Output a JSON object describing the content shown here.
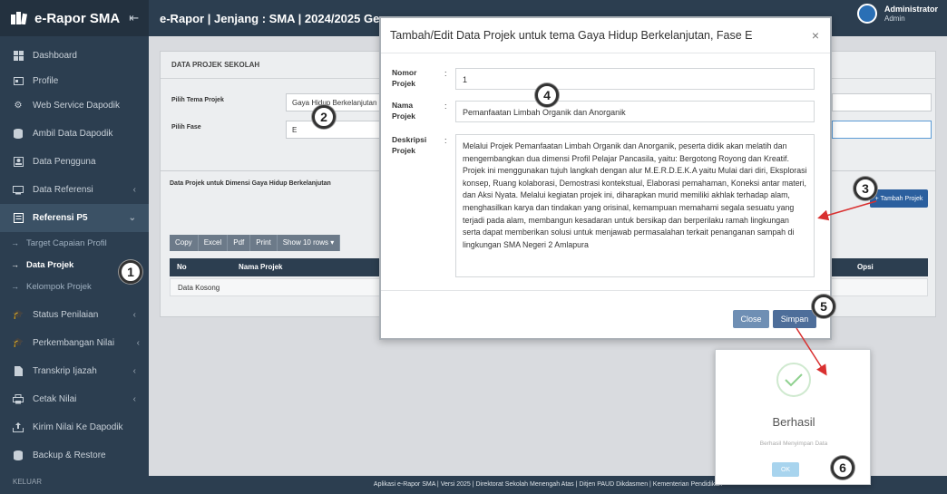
{
  "app": {
    "brand": "e-Rapor SMA",
    "topbar_title": "e-Rapor | Jenjang : SMA | 2024/2025 Ge",
    "user_name": "Administrator",
    "user_role": "Admin"
  },
  "sidebar": {
    "items": [
      {
        "label": "Dashboard",
        "icon": "dashboard-icon"
      },
      {
        "label": "Profile",
        "icon": "id-card-icon"
      },
      {
        "label": "Web Service Dapodik",
        "icon": "gear-icon"
      },
      {
        "label": "Ambil Data Dapodik",
        "icon": "database-icon"
      },
      {
        "label": "Data Pengguna",
        "icon": "users-icon"
      },
      {
        "label": "Data Referensi",
        "icon": "monitor-icon"
      },
      {
        "label": "Referensi P5",
        "icon": "list-icon"
      }
    ],
    "sub_items": [
      "Target Capaian Profil",
      "Data Projek",
      "Kelompok Projek"
    ],
    "items_after": [
      {
        "label": "Status Penilaian",
        "icon": "cap-icon"
      },
      {
        "label": "Perkembangan Nilai",
        "icon": "cap-icon"
      },
      {
        "label": "Transkrip Ijazah",
        "icon": "file-icon"
      },
      {
        "label": "Cetak Nilai",
        "icon": "printer-icon"
      },
      {
        "label": "Kirim Nilai Ke Dapodik",
        "icon": "upload-icon"
      },
      {
        "label": "Backup & Restore",
        "icon": "database-icon"
      }
    ],
    "logout": "KELUAR"
  },
  "page": {
    "section_title": "DATA PROJEK SEKOLAH",
    "pilih_tema_label": "Pilih Tema Projek",
    "pilih_tema_value": "Gaya Hidup Berkelanjutan",
    "pilih_fase_label": "Pilih Fase",
    "pilih_fase_value": "E",
    "table_title": "Data Projek untuk Dimensi Gaya Hidup Berkelanjutan",
    "tambah_button": "Tambah Projek",
    "export_buttons": [
      "Copy",
      "Excel",
      "Pdf",
      "Print",
      "Show 10 rows ▾"
    ],
    "col_no": "No",
    "col_nama": "Nama Projek",
    "col_opsi": "Opsi",
    "empty_text": "Data Kosong"
  },
  "modal": {
    "title": "Tambah/Edit Data Projek untuk tema Gaya Hidup Berkelanjutan, Fase E",
    "close_x": "×",
    "nomor_label": "Nomor Projek",
    "nomor_value": "1",
    "nama_label": "Nama Projek",
    "nama_value": "Pemanfaatan Limbah Organik dan Anorganik",
    "deskripsi_label": "Deskripsi Projek",
    "deskripsi_value": "Melalui Projek Pemanfaatan Limbah Organik dan Anorganik, peserta didik akan melatih dan mengembangkan dua dimensi Profil Pelajar Pancasila, yaitu: Bergotong Royong dan Kreatif. Projek ini menggunakan tujuh langkah dengan alur M.E.R.D.E.K.A yaitu Mulai dari diri, Eksplorasi konsep, Ruang kolaborasi, Demostrasi kontekstual, Elaborasi pemahaman, Koneksi antar materi, dan Aksi Nyata. Melalui kegiatan projek ini, diharapkan murid memiliki akhlak terhadap alam, menghasilkan karya dan tindakan yang orisinal, kemampuan memahami segala sesuatu yang terjadi pada alam, membangun kesadaran untuk bersikap dan berperilaku ramah lingkungan serta dapat memberikan solusi untuk menjawab permasalahan terkait penanganan sampah di lingkungan SMA Negeri 2 Amlapura",
    "close_button": "Close",
    "save_button": "Simpan"
  },
  "success": {
    "title": "Berhasil",
    "message": "Berhasil Menyimpan Data",
    "ok": "OK"
  },
  "footer": "Aplikasi e-Rapor SMA | Versi 2025 | Direktorat Sekolah Menengah Atas | Ditjen PAUD Dikdasmen | Kementerian Pendidikan",
  "callouts": [
    "1",
    "2",
    "3",
    "4",
    "5",
    "6"
  ],
  "colors": {
    "sidebar": "#2c3e50",
    "primary": "#2b5f9e",
    "arrow": "#d93030"
  }
}
